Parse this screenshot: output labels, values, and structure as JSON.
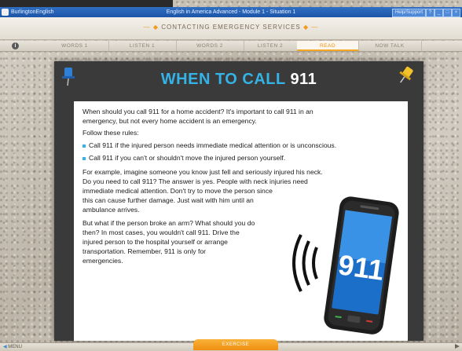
{
  "window": {
    "app_name": "BurlingtonEnglish",
    "title": "English in America Advanced - Module 1 - Situation 1",
    "help_label": "Help/Support",
    "controls": [
      "?",
      "_",
      "□",
      "×"
    ]
  },
  "header": {
    "section_title": "CONTACTING EMERGENCY SERVICES"
  },
  "tabs": [
    {
      "label": "WORDS 1",
      "active": false
    },
    {
      "label": "LISTEN 1",
      "active": false
    },
    {
      "label": "WORDS 2",
      "active": false
    },
    {
      "label": "LISTEN 2",
      "active": false
    },
    {
      "label": "READ",
      "active": true
    },
    {
      "label": "NOW TALK",
      "active": false
    }
  ],
  "reading": {
    "title_part1": "WHEN TO CALL",
    "title_part2": "911",
    "p1_line1": "When should you call 911 for a home accident? It's important to call 911 in an",
    "p1_line2": "emergency, but not every home accident is an emergency.",
    "rules_intro": "Follow these rules:",
    "rules": [
      "Call 911 if the injured person needs immediate medical attention or is unconscious.",
      "Call 911 if you can't or shouldn't move the injured person yourself."
    ],
    "p2_lines": [
      "For example, imagine someone you know just fell and seriously injured his neck.",
      "Do you need to call 911? The answer is yes. People with neck injuries need",
      "immediate medical attention. Don't try to move the person since",
      "this can cause further damage. Just wait with him until an",
      "ambulance arrives."
    ],
    "p3_lines": [
      "But what if the person broke an arm? What should you do",
      "then? In most cases, you wouldn't call 911. Drive the",
      "injured person to the hospital yourself or arrange",
      "transportation. Remember, 911 is only for",
      "emergencies."
    ],
    "phone_screen_text": "911"
  },
  "footer": {
    "menu_label": "MENU",
    "exercise_label": "EXERCISE"
  },
  "colors": {
    "accent": "#35b3e6",
    "tab_active": "#f5a623",
    "panel": "#3a3a3a"
  },
  "icons": [
    "info-icon",
    "blue-pushpin-icon",
    "yellow-pushpin-icon",
    "phone-illustration",
    "menu-arrow-icon",
    "next-arrow-icon"
  ]
}
